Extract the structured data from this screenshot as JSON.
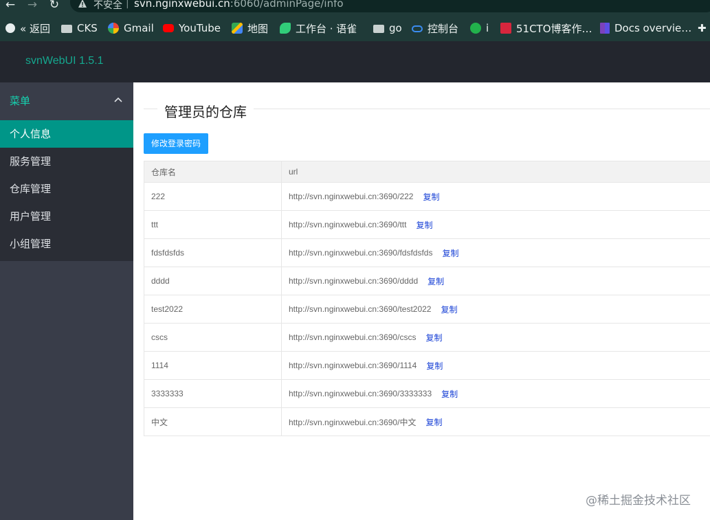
{
  "browser": {
    "insecure_label": "不安全",
    "separator": "|",
    "url_host": "svn.nginxwebui.cn",
    "url_rest": ":6060/adminPage/info",
    "bookmarks": [
      {
        "label": "« 返回",
        "icon": "globe-icon"
      },
      {
        "label": "CKS",
        "icon": "folder-icon"
      },
      {
        "label": "Gmail",
        "icon": "google-icon"
      },
      {
        "label": "YouTube",
        "icon": "youtube-icon"
      },
      {
        "label": "地图",
        "icon": "maps-icon"
      },
      {
        "label": "工作台 · 语雀",
        "icon": "yuque-icon"
      },
      {
        "label": "go",
        "icon": "folder-icon"
      },
      {
        "label": "控制台",
        "icon": "cloud-icon"
      },
      {
        "label": "i",
        "icon": "s-icon"
      },
      {
        "label": "51CTO博客作…",
        "icon": "51cto-icon"
      },
      {
        "label": "Docs overvie…",
        "icon": "terraform-icon"
      }
    ]
  },
  "app": {
    "title": "svnWebUI 1.5.1"
  },
  "sidebar": {
    "menu_label": "菜单",
    "items": [
      {
        "label": "个人信息",
        "active": true
      },
      {
        "label": "服务管理",
        "active": false
      },
      {
        "label": "仓库管理",
        "active": false
      },
      {
        "label": "用户管理",
        "active": false
      },
      {
        "label": "小组管理",
        "active": false
      }
    ]
  },
  "main": {
    "page_title": "管理员的仓库",
    "change_password_label": "修改登录密码",
    "table": {
      "headers": [
        "仓库名",
        "url"
      ],
      "copy_label": "复制",
      "rows": [
        {
          "name": "222",
          "url": "http://svn.nginxwebui.cn:3690/222"
        },
        {
          "name": "ttt",
          "url": "http://svn.nginxwebui.cn:3690/ttt"
        },
        {
          "name": "fdsfdsfds",
          "url": "http://svn.nginxwebui.cn:3690/fdsfdsfds"
        },
        {
          "name": "dddd",
          "url": "http://svn.nginxwebui.cn:3690/dddd"
        },
        {
          "name": "test2022",
          "url": "http://svn.nginxwebui.cn:3690/test2022"
        },
        {
          "name": "cscs",
          "url": "http://svn.nginxwebui.cn:3690/cscs"
        },
        {
          "name": "1114",
          "url": "http://svn.nginxwebui.cn:3690/1114"
        },
        {
          "name": "3333333",
          "url": "http://svn.nginxwebui.cn:3690/3333333"
        },
        {
          "name": "中文",
          "url": "http://svn.nginxwebui.cn:3690/中文"
        }
      ]
    }
  },
  "watermark": "@稀土掘金技术社区",
  "colors": {
    "accent": "#009688",
    "button": "#1e9fff",
    "link": "#1b43d6",
    "header_bg": "#23262e",
    "sidebar_bg": "#393d49"
  }
}
